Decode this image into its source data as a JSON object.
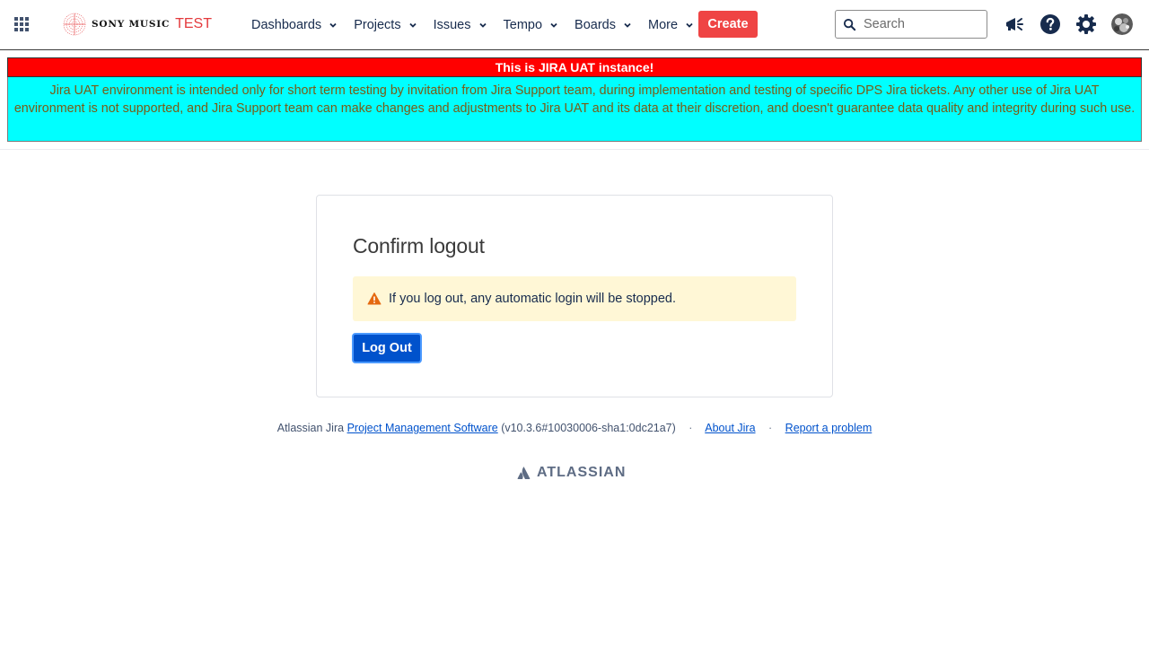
{
  "header": {
    "brand": {
      "name": "SONY MUSIC",
      "suffix": "TEST"
    },
    "nav": [
      {
        "label": "Dashboards"
      },
      {
        "label": "Projects"
      },
      {
        "label": "Issues"
      },
      {
        "label": "Tempo"
      },
      {
        "label": "Boards"
      },
      {
        "label": "More"
      }
    ],
    "create_label": "Create",
    "search": {
      "placeholder": "Search",
      "value": ""
    },
    "icons": [
      "app-switcher-icon",
      "notifications-megaphone-icon",
      "help-icon",
      "settings-gear-icon",
      "user-avatar"
    ],
    "create_color": "#ef4444"
  },
  "banner": {
    "title": "This is JIRA UAT instance!",
    "body": "Jira UAT environment is intended only for short term testing by invitation from Jira Support team, during implementation and testing of specific DPS Jira tickets. Any other use of Jira UAT environment is not supported, and Jira Support team can make changes and adjustments to Jira UAT and its data at their discretion, and doesn't guarantee data quality and integrity during such use.",
    "title_bg": "#ff0000",
    "body_bg": "#00ffff"
  },
  "card": {
    "title": "Confirm logout",
    "warning": "If you log out, any automatic login will be stopped.",
    "button": "Log Out",
    "button_color": "#0052cc"
  },
  "footer": {
    "prefix": "Atlassian Jira",
    "link_pms": "Project Management Software",
    "version": "(v10.3.6#10030006-sha1:0dc21a7)",
    "about": "About Jira",
    "report": "Report a problem",
    "separator": "·",
    "brand": "ATLASSIAN"
  }
}
